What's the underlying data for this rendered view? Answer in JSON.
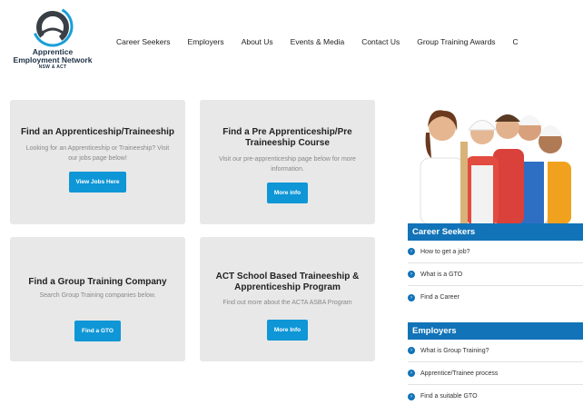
{
  "logo": {
    "line1": "Apprentice",
    "line2": "Employment Network",
    "line3": "NSW & ACT"
  },
  "nav": {
    "items": [
      "Career Seekers",
      "Employers",
      "About Us",
      "Events & Media",
      "Contact Us",
      "Group Training Awards",
      "C"
    ]
  },
  "cards": [
    {
      "title": "Find an Apprenticeship/Traineeship",
      "desc": "Looking for an Apprenticeship or Traineeship? Visit our jobs page below!",
      "button": "View Jobs Here"
    },
    {
      "title": "Find a Pre Apprenticeship/Pre Traineeship Course",
      "desc": "Visit our pre-apprenticeship page below for more information.",
      "button": "More info"
    },
    {
      "title": "Find a Group Training Company",
      "desc": "Search Group Training companies below.",
      "button": "Find a GTO"
    },
    {
      "title": "ACT School Based Traineeship & Apprenticeship Program",
      "desc": "Find out more about the ACTA ASBA Program",
      "button": "More Info"
    }
  ],
  "sidebar": {
    "career_header": "Career Seekers",
    "career_items": [
      "How to get a job?",
      "What is a GTO",
      "Find a Career"
    ],
    "employers_header": "Employers",
    "employers_items": [
      "What is Group Training?",
      "Apprentice/Trainee process",
      "Find a suitable GTO"
    ]
  },
  "colors": {
    "accent": "#0e96d6",
    "header_blue": "#1273b8",
    "card_bg": "#e8e8e8"
  }
}
